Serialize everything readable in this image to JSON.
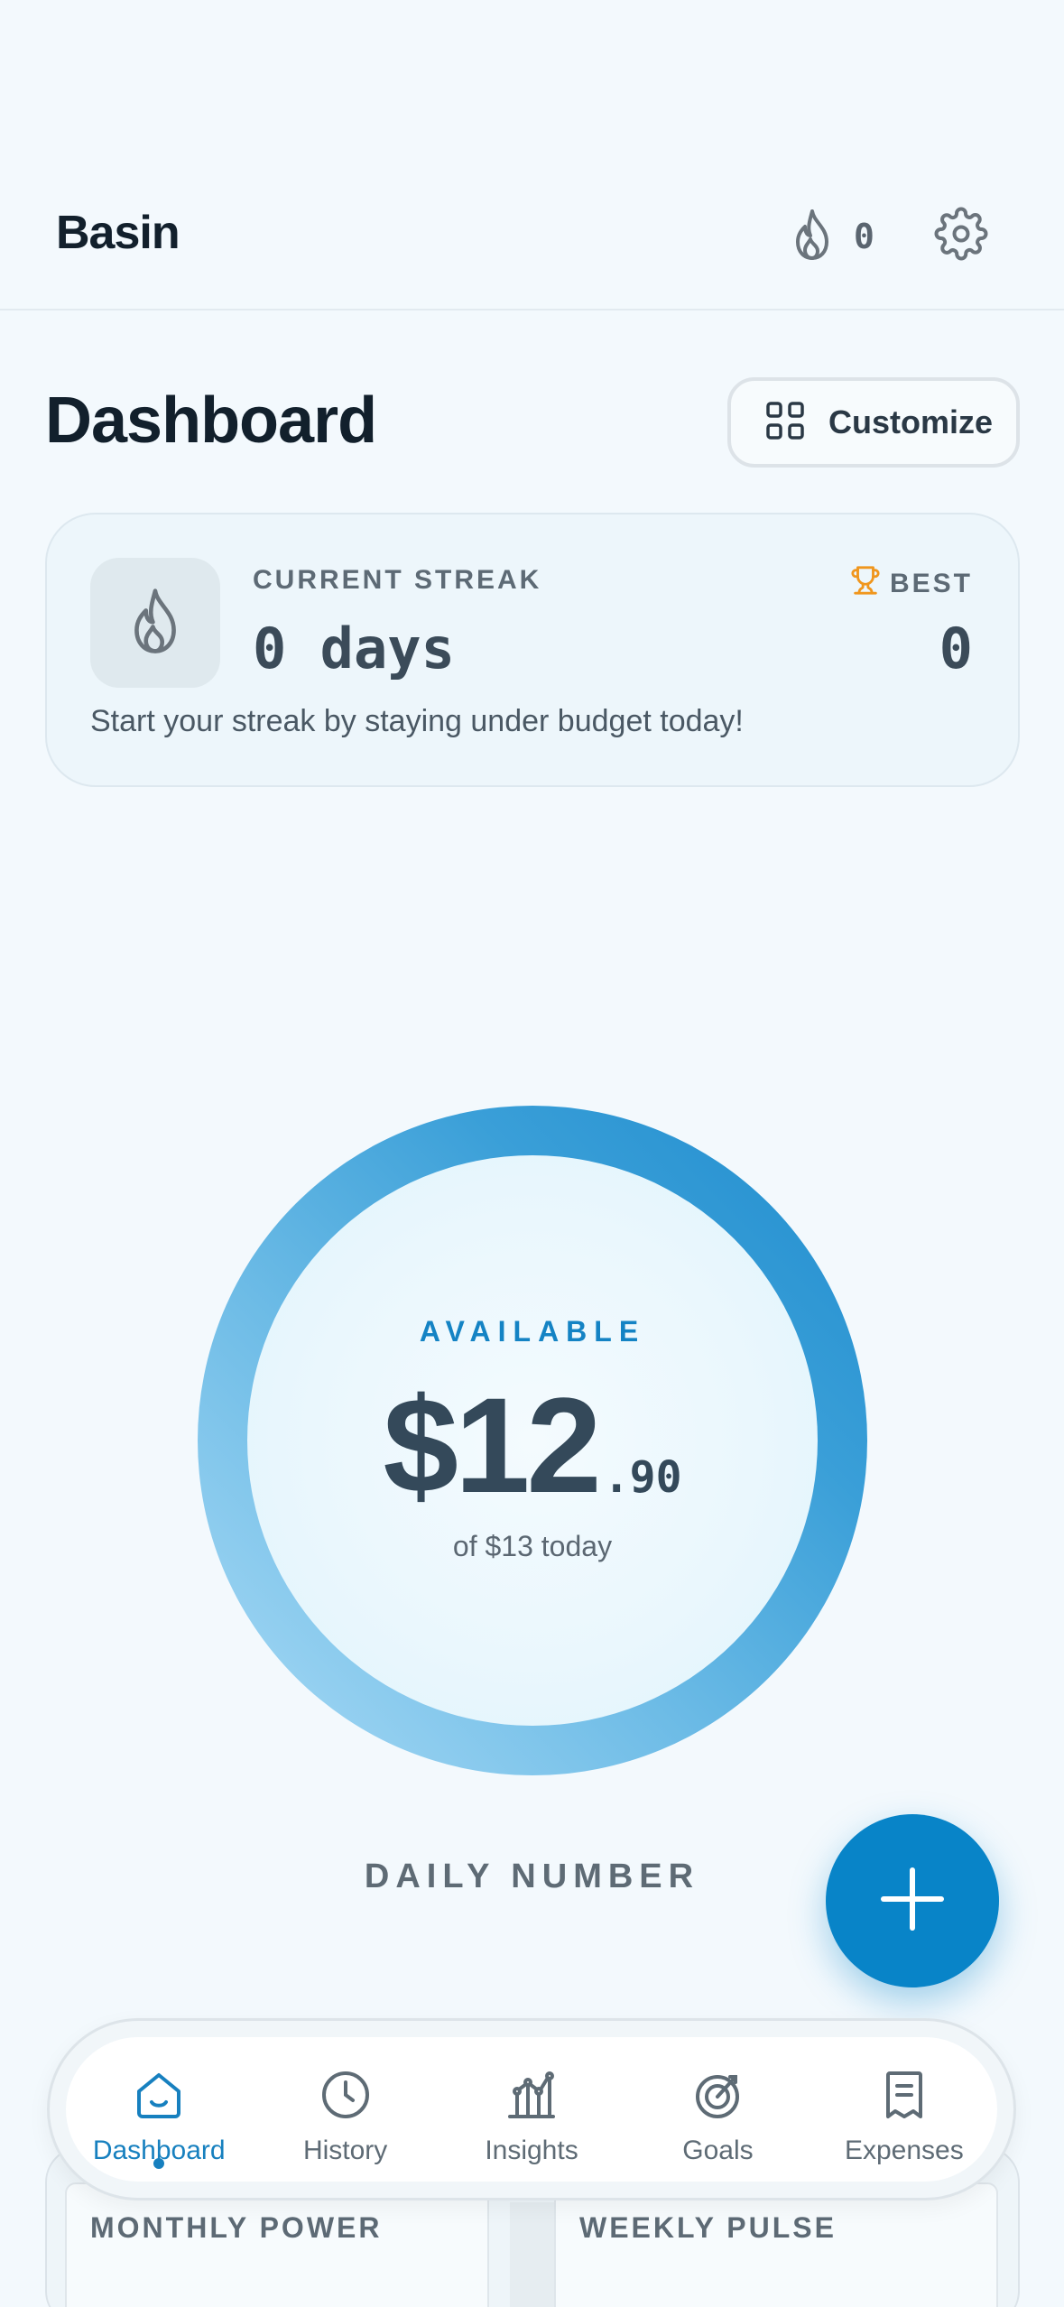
{
  "header": {
    "brand": "Basin",
    "streak_count": "0",
    "icons": {
      "streak": "flame-icon",
      "settings": "gear-icon"
    }
  },
  "page": {
    "title": "Dashboard",
    "customize_label": "Customize"
  },
  "streak_card": {
    "label": "CURRENT STREAK",
    "value": "0 days",
    "best_label": "BEST",
    "best_value": "0",
    "hint": "Start your streak by staying under budget today!"
  },
  "ring": {
    "available_label": "AVAILABLE",
    "amount_major": "$12",
    "amount_minor": ".90",
    "of_total": "of $13 today",
    "fraction_remaining": 0.99,
    "caption": "DAILY NUMBER"
  },
  "cards": {
    "monthly_title": "MONTHLY POWER",
    "weekly_title": "WEEKLY PULSE"
  },
  "nav": {
    "items": [
      {
        "label": "Dashboard",
        "icon": "home-icon",
        "active": true
      },
      {
        "label": "History",
        "icon": "clock-icon",
        "active": false
      },
      {
        "label": "Insights",
        "icon": "chart-icon",
        "active": false
      },
      {
        "label": "Goals",
        "icon": "target-icon",
        "active": false
      },
      {
        "label": "Expenses",
        "icon": "receipt-icon",
        "active": false
      }
    ]
  },
  "colors": {
    "accent": "#0884c8",
    "background": "#f3f9fd",
    "trophy": "#f0961d"
  }
}
